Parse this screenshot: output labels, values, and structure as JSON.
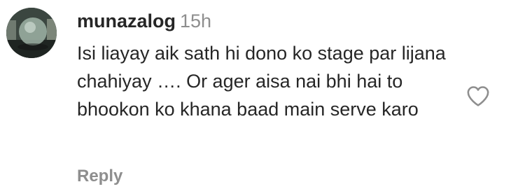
{
  "comment": {
    "username": "munazalog",
    "timestamp": "15h",
    "text": "Isi liayay aik sath hi dono ko stage par lijana chahiyay …. Or ager aisa nai bhi hai to bhookon ko khana baad main serve karo",
    "reply_label": "Reply",
    "icons": {
      "avatar": "avatar-photo",
      "like": "heart-outline-icon"
    },
    "colors": {
      "text": "#262626",
      "muted": "#8e8e8e"
    }
  }
}
